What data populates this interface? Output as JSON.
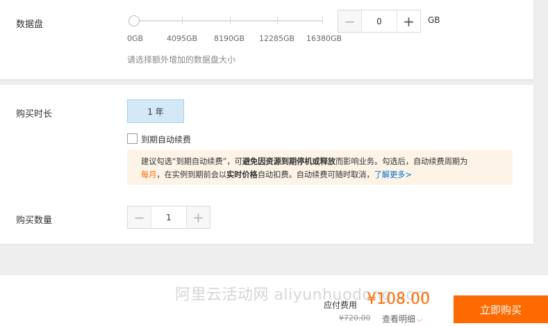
{
  "data_disk": {
    "label": "数据盘",
    "slider_ticks": [
      "0GB",
      "4095GB",
      "8190GB",
      "12285GB",
      "16380GB"
    ],
    "value": "0",
    "unit": "GB",
    "hint": "请选择额外增加的数据盘大小"
  },
  "duration": {
    "label": "购买时长",
    "selected": "1 年",
    "auto_renew_label": "到期自动续费",
    "notice": {
      "part1": "建议勾选“到期自动续费”，可",
      "bold1": "避免因资源到期停机或释放",
      "part2": "而影响业务。勾选后，自动续费周期为",
      "orange1": "每月",
      "part3": "，在实例到期前会以",
      "bold2": "实时价格",
      "part4": "自动扣费。自动续费可随时取消，",
      "link": "了解更多>"
    }
  },
  "quantity": {
    "label": "购买数量",
    "value": "1"
  },
  "footer": {
    "watermark": "阿里云活动网 aliyunhuodong.com",
    "fee_label": "应付费用",
    "price": "¥108.00",
    "original_price": "¥720.00",
    "detail_link": "查看明细",
    "buy_button": "立即购买"
  }
}
